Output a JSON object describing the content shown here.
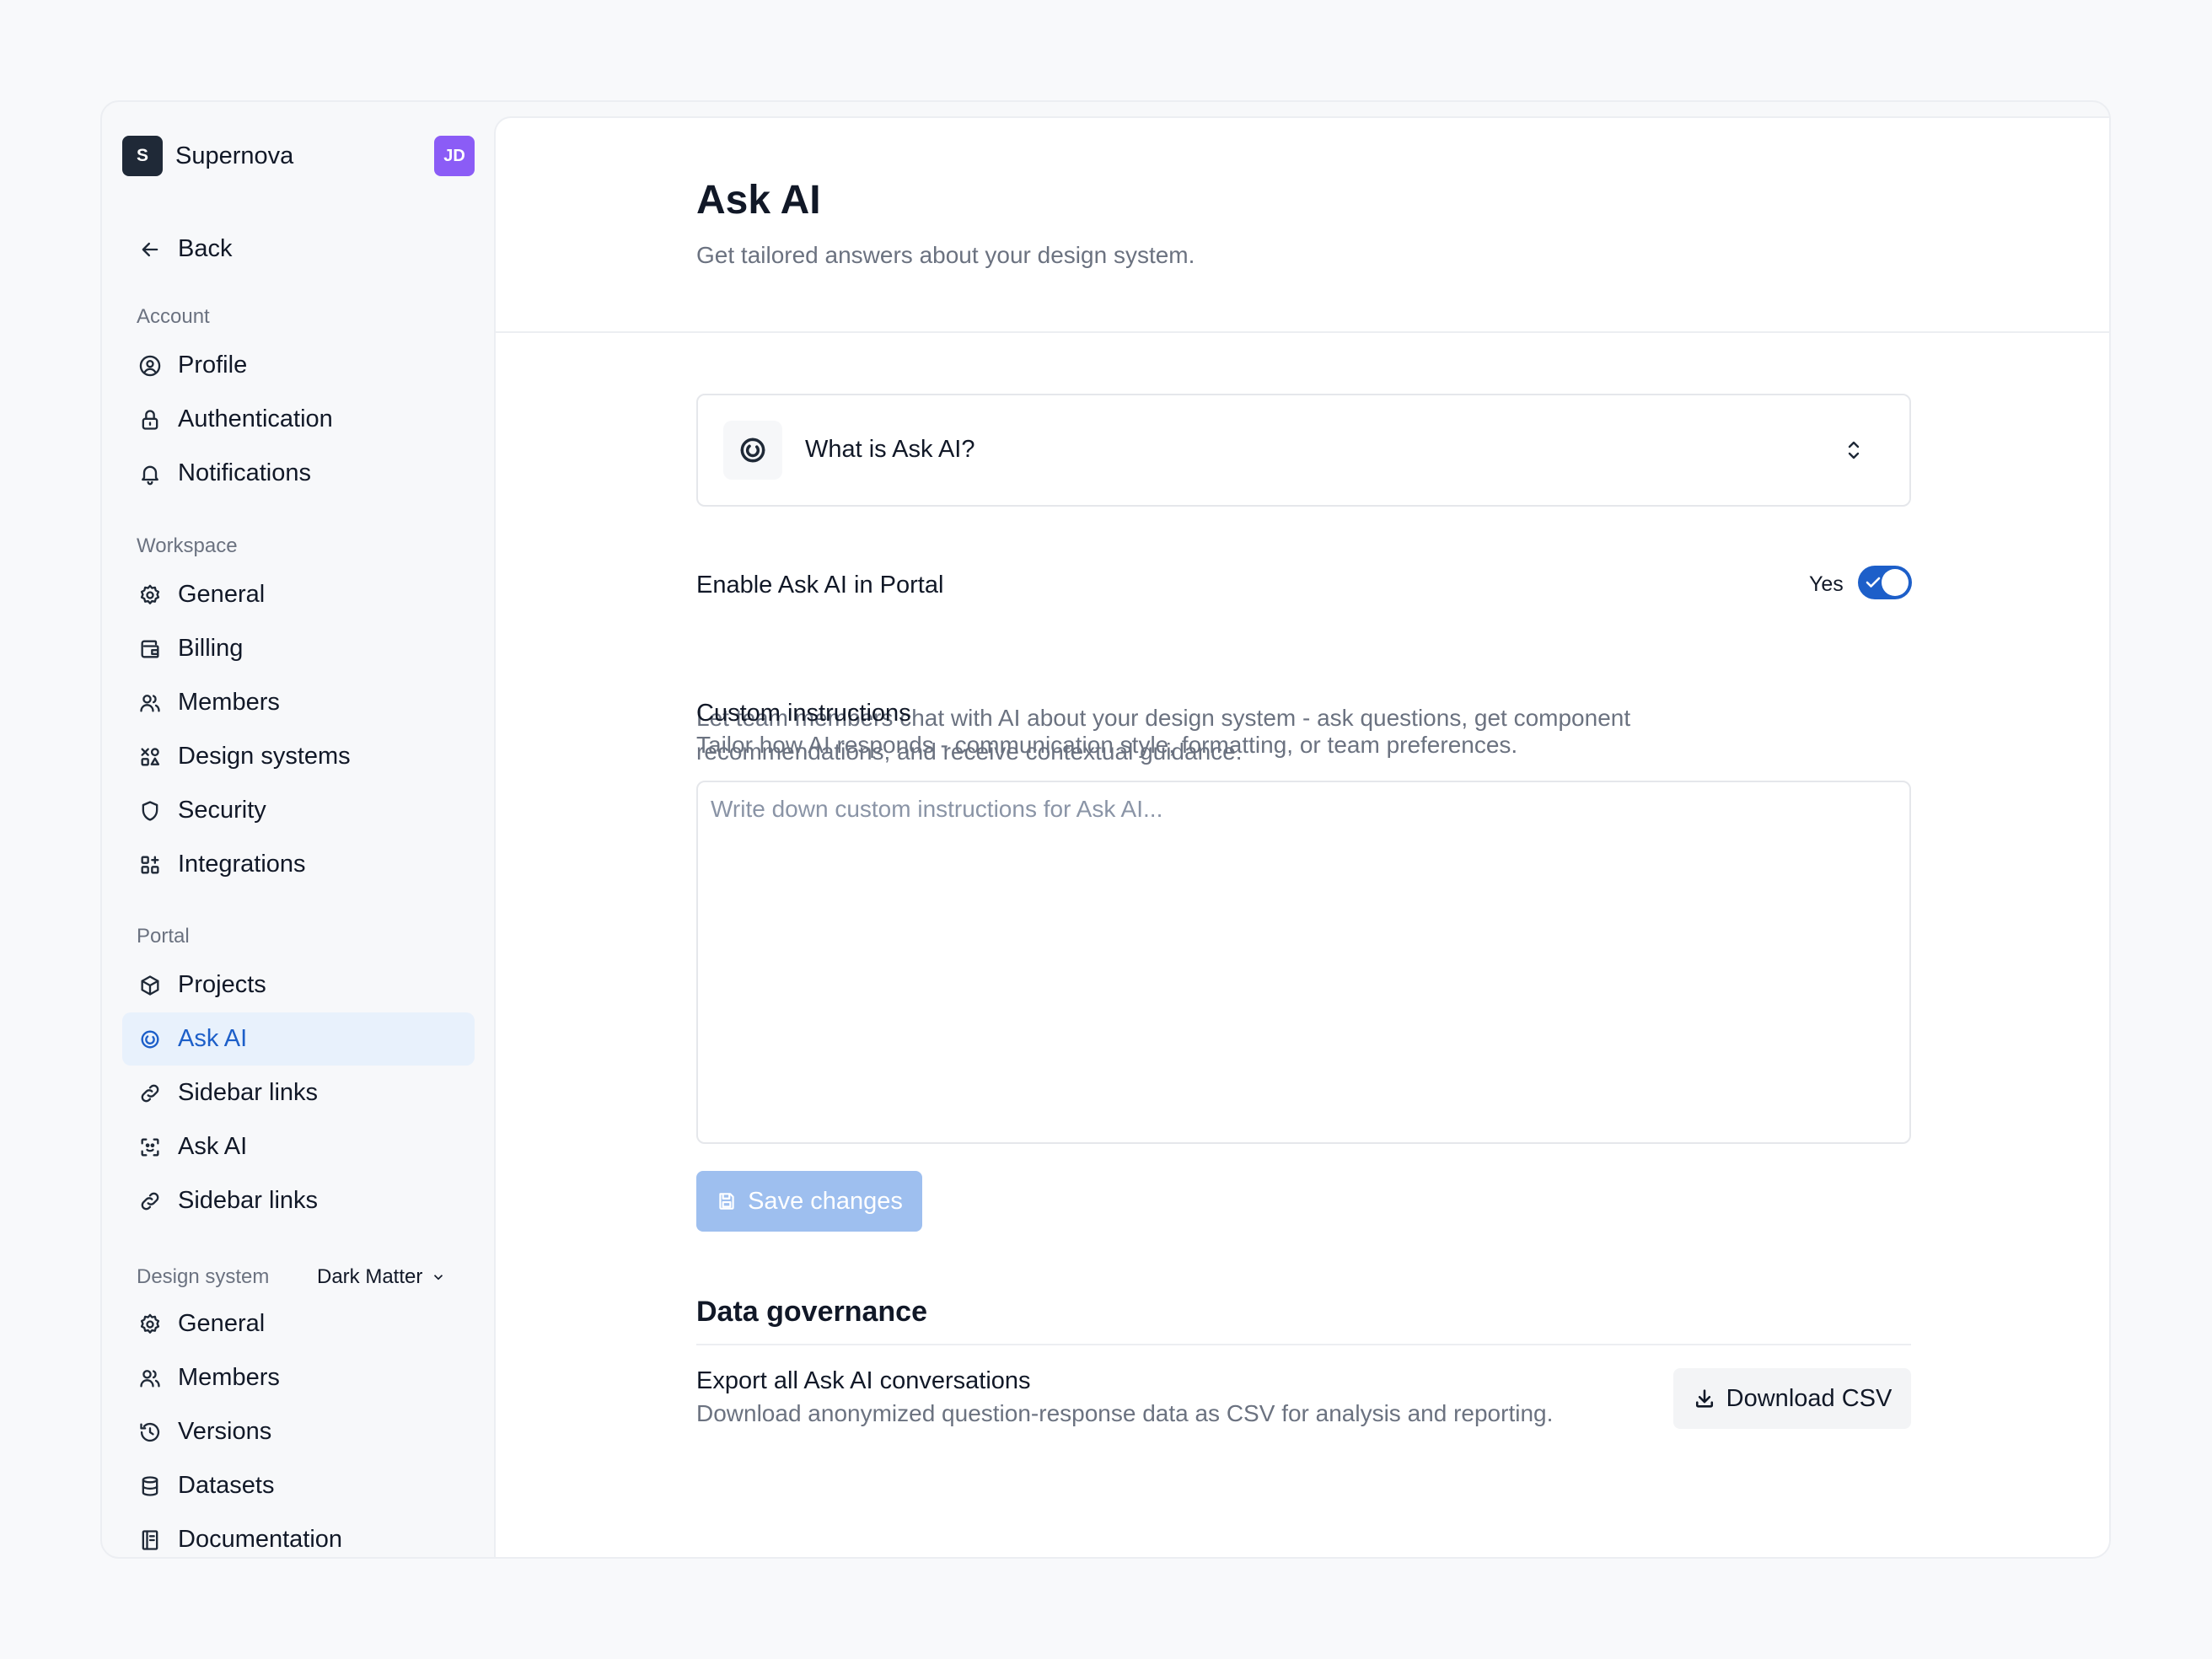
{
  "brand": {
    "initial": "S",
    "name": "Supernova",
    "avatar_initials": "JD"
  },
  "sidebar": {
    "back_label": "Back",
    "account": {
      "label": "Account",
      "items": [
        {
          "label": "Profile",
          "icon": "user-circle-icon"
        },
        {
          "label": "Authentication",
          "icon": "lock-icon"
        },
        {
          "label": "Notifications",
          "icon": "bell-icon"
        }
      ]
    },
    "workspace": {
      "label": "Workspace",
      "items": [
        {
          "label": "General",
          "icon": "gear-icon"
        },
        {
          "label": "Billing",
          "icon": "wallet-icon"
        },
        {
          "label": "Members",
          "icon": "users-icon"
        },
        {
          "label": "Design systems",
          "icon": "shapes-icon"
        },
        {
          "label": "Security",
          "icon": "shield-icon"
        },
        {
          "label": "Integrations",
          "icon": "grid-plus-icon"
        }
      ]
    },
    "portal": {
      "label": "Portal",
      "items": [
        {
          "label": "Projects",
          "icon": "box-icon"
        },
        {
          "label": "Ask AI",
          "icon": "swirl-icon",
          "active": true
        },
        {
          "label": "Sidebar links",
          "icon": "link-icon"
        },
        {
          "label": "Ask AI",
          "icon": "scan-face-icon"
        },
        {
          "label": "Sidebar links",
          "icon": "link-icon"
        }
      ]
    },
    "design_system": {
      "label": "Design system",
      "selected": "Dark Matter",
      "items": [
        {
          "label": "General",
          "icon": "gear-icon"
        },
        {
          "label": "Members",
          "icon": "users-icon"
        },
        {
          "label": "Versions",
          "icon": "history-icon"
        },
        {
          "label": "Datasets",
          "icon": "database-icon"
        },
        {
          "label": "Documentation",
          "icon": "book-icon"
        }
      ]
    }
  },
  "main": {
    "title": "Ask AI",
    "subtitle": "Get tailored answers about your design system.",
    "accordion_label": "What is Ask AI?",
    "enable": {
      "title": "Enable Ask AI in Portal",
      "description_line1": "Let team members chat with AI about your design system - ask questions, get component",
      "description_line2": "recommendations, and receive contextual guidance.",
      "toggle_label": "Yes",
      "enabled": true
    },
    "custom_instructions": {
      "title": "Custom instructions",
      "description": "Tailor how AI responds - communication style, formatting, or team preferences.",
      "placeholder": "Write down custom instructions for Ask AI...",
      "value": ""
    },
    "save_label": "Save changes",
    "governance": {
      "heading": "Data governance",
      "export_title": "Export all Ask AI conversations",
      "export_description": "Download anonymized question-response data as CSV for analysis and reporting.",
      "download_label": "Download CSV"
    }
  },
  "colors": {
    "accent": "#1d5fc9",
    "active_bg": "#e8f1fc",
    "avatar": "#8b5cf6",
    "save_disabled": "#9ebfef"
  }
}
